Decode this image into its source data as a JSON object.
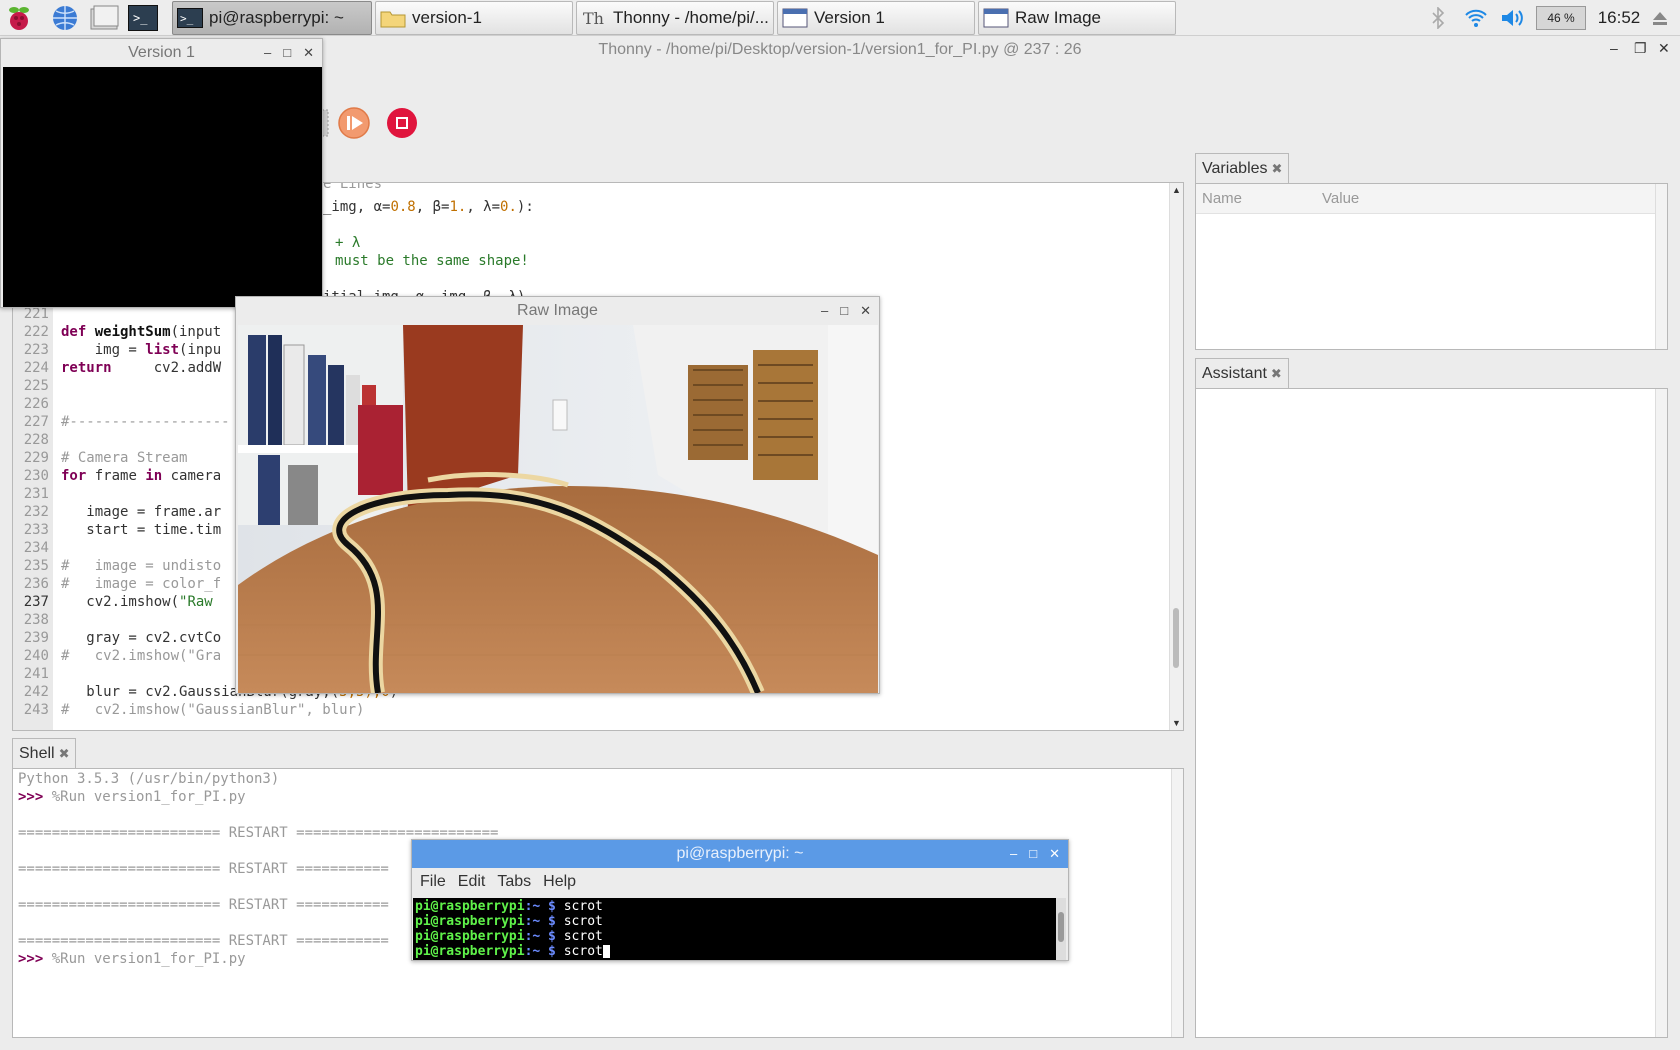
{
  "taskbar": {
    "tasks": [
      {
        "label": "pi@raspberrypi: ~"
      },
      {
        "label": "version-1"
      },
      {
        "label": "Thonny  -  /home/pi/..."
      },
      {
        "label": "Version 1"
      },
      {
        "label": "Raw Image"
      }
    ],
    "battery": "46 %",
    "clock": "16:52"
  },
  "thonny": {
    "title": "Thonny  -  /home/pi/Desktop/version-1/version1_for_PI.py  @  237 : 26"
  },
  "editor": {
    "partial_lines": [
      {
        "html_text": "e Lines"
      },
      {
        "text_a": "_img, α=",
        "num1": "0.8",
        "text_b": ", β=",
        "num2": "1.",
        "text_c": ", λ=",
        "num3": "0.",
        "text_d": "):"
      },
      {
        "text": "+ λ"
      },
      {
        "text": "must be the same shape!"
      },
      {
        "text": "itial_img, α, img, β, λ)"
      }
    ],
    "lines": [
      {
        "n": "221",
        "text": ""
      },
      {
        "n": "222",
        "kw": "def ",
        "fn": "weightSum",
        "text": "(input"
      },
      {
        "n": "223",
        "text": "    img = ",
        "kw2": "list",
        "text2": "(inpu"
      },
      {
        "n": "224",
        "text": "    ",
        "kw": "return",
        "text2": " cv2.addW"
      },
      {
        "n": "225",
        "text": ""
      },
      {
        "n": "226",
        "text": ""
      },
      {
        "n": "227",
        "cm": "#-------------------"
      },
      {
        "n": "228",
        "text": ""
      },
      {
        "n": "229",
        "cm": "# Camera Stream"
      },
      {
        "n": "230",
        "kw": "for",
        "text": " frame ",
        "kw2": "in",
        "text2": " camera"
      },
      {
        "n": "231",
        "text": ""
      },
      {
        "n": "232",
        "text": "   image = frame.ar"
      },
      {
        "n": "233",
        "text": "   start = time.tim"
      },
      {
        "n": "234",
        "text": ""
      },
      {
        "n": "235",
        "cm": "#   image = undisto"
      },
      {
        "n": "236",
        "cm": "#   image = color_f"
      },
      {
        "n": "237",
        "text": "   cv2.imshow(",
        "str": "\"Raw"
      },
      {
        "n": "238",
        "text": ""
      },
      {
        "n": "239",
        "text": "   gray = cv2.cvtCo"
      },
      {
        "n": "240",
        "cm": "#   cv2.imshow(\"Gra"
      },
      {
        "n": "241",
        "text": ""
      },
      {
        "n": "242",
        "text": "   blur = cv2.GaussianBlur(gray,(",
        "num": "5,5),0",
        "text2": ")"
      },
      {
        "n": "243",
        "cm": "#   cv2.imshow(\"GaussianBlur\", blur)"
      }
    ]
  },
  "variables": {
    "tab": "Variables",
    "col_name": "Name",
    "col_value": "Value"
  },
  "assistant": {
    "tab": "Assistant"
  },
  "shell": {
    "tab": "Shell",
    "lines": [
      {
        "text": "Python 3.5.3 (/usr/bin/python3)"
      },
      {
        "prompt": ">>>",
        "text": " %Run version1_for_PI.py"
      },
      {
        "text": ""
      },
      {
        "text": "======================== RESTART ========================"
      },
      {
        "text": ""
      },
      {
        "text": "======================== RESTART ==========="
      },
      {
        "text": ""
      },
      {
        "text": "======================== RESTART ==========="
      },
      {
        "text": ""
      },
      {
        "text": "======================== RESTART ==========="
      },
      {
        "prompt": ">>>",
        "text": " %Run version1_for_PI.py"
      }
    ]
  },
  "version1_window": {
    "title": "Version 1"
  },
  "raw_image_window": {
    "title": "Raw Image"
  },
  "terminal": {
    "title": "pi@raspberrypi: ~",
    "menu": [
      "File",
      "Edit",
      "Tabs",
      "Help"
    ],
    "lines": [
      {
        "user": "pi@raspberrypi",
        "path": ":~ $",
        "cmd": " scrot"
      },
      {
        "user": "pi@raspberrypi",
        "path": ":~ $",
        "cmd": " scrot"
      },
      {
        "user": "pi@raspberrypi",
        "path": ":~ $",
        "cmd": " scrot"
      },
      {
        "user": "pi@raspberrypi",
        "path": ":~ $",
        "cmd": " scrot"
      }
    ]
  },
  "colors": {
    "terminal_title_bg": "#5b9ae6",
    "stop_button": "#e0153d",
    "resume_button": "#f29a6f"
  }
}
